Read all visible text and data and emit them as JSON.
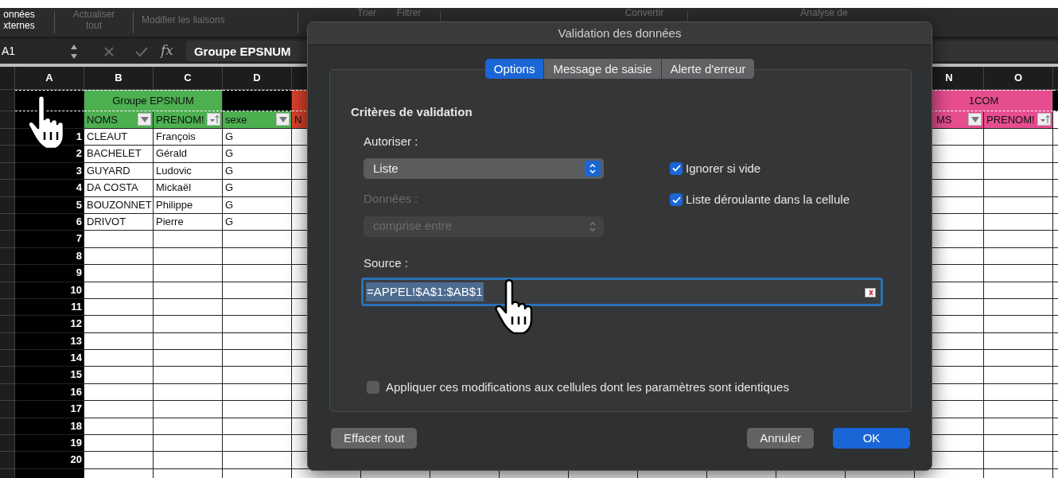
{
  "ribbon": {
    "items": [
      {
        "label": "onnées xternes",
        "disabled": false
      },
      {
        "label": "Actualiser tout",
        "disabled": true
      },
      {
        "label": "Modifier les liaisons",
        "disabled": true
      },
      {
        "label": "Trier",
        "disabled": true
      },
      {
        "label": "Filtrer",
        "disabled": true
      },
      {
        "label": "Convertir",
        "disabled": true
      },
      {
        "label": "Analyse de",
        "disabled": true
      }
    ]
  },
  "formula_bar": {
    "name_box": "A1",
    "function_label": "fx",
    "content": "Groupe EPSNUM"
  },
  "sheet": {
    "left_columns": [
      {
        "label": "A"
      },
      {
        "label": "B"
      },
      {
        "label": "C"
      },
      {
        "label": "D"
      }
    ],
    "right_columns": [
      {
        "label": "N"
      },
      {
        "label": "O"
      }
    ],
    "left_group": {
      "title": "Groupe EPSNUM",
      "color": "#4caf50",
      "headers": [
        {
          "label": "NOMS",
          "kind": "filter"
        },
        {
          "label": "PRENOM!",
          "kind": "sort"
        },
        {
          "label": "sexe",
          "kind": "filter"
        }
      ],
      "next_column": {
        "label": "N",
        "color": "#d9412c"
      }
    },
    "right_group": {
      "title": "1COM",
      "color": "#e64d8f",
      "headers": [
        {
          "label": "MS",
          "kind": "filter"
        },
        {
          "label": "PRENOM!",
          "kind": "sort"
        }
      ]
    },
    "rows": [
      {
        "number": "1",
        "cells": [
          "CLEAUT",
          "François",
          "G"
        ]
      },
      {
        "number": "2",
        "cells": [
          "BACHELET",
          "Gérald",
          "G"
        ]
      },
      {
        "number": "3",
        "cells": [
          "GUYARD",
          "Ludovic",
          "G"
        ]
      },
      {
        "number": "4",
        "cells": [
          "DA COSTA",
          "Mickaël",
          "G"
        ]
      },
      {
        "number": "5",
        "cells": [
          "BOUZONNET",
          "Philippe",
          "G"
        ]
      },
      {
        "number": "6",
        "cells": [
          "DRIVOT",
          "Pierre",
          "G"
        ]
      },
      {
        "number": "7"
      },
      {
        "number": "8"
      },
      {
        "number": "9"
      },
      {
        "number": "10"
      },
      {
        "number": "11"
      },
      {
        "number": "12"
      },
      {
        "number": "13"
      },
      {
        "number": "14"
      },
      {
        "number": "15"
      },
      {
        "number": "16"
      },
      {
        "number": "17"
      },
      {
        "number": "18"
      },
      {
        "number": "19"
      },
      {
        "number": "20"
      }
    ]
  },
  "dialog": {
    "title": "Validation des données",
    "tabs": [
      {
        "label": "Options",
        "selected": true
      },
      {
        "label": "Message de saisie",
        "selected": false
      },
      {
        "label": "Alerte d'erreur",
        "selected": false
      }
    ],
    "section_title": "Critères de validation",
    "allow": {
      "label": "Autoriser :",
      "value": "Liste",
      "disabled": false
    },
    "data": {
      "label": "Données :",
      "value": "comprise entre",
      "disabled": true
    },
    "checkboxes": [
      {
        "label": "Ignorer si vide",
        "checked": true
      },
      {
        "label": "Liste déroulante dans la cellule",
        "checked": true
      }
    ],
    "source": {
      "label": "Source :",
      "value": "=APPEL!$A$1:$AB$1",
      "selected": true
    },
    "apply": {
      "label": "Appliquer ces modifications aux cellules dont les paramètres sont identiques",
      "checked": false
    },
    "buttons_left": [
      {
        "label": "Effacer tout",
        "kind": "secondary"
      }
    ],
    "buttons_right": [
      {
        "label": "Annuler",
        "kind": "secondary"
      },
      {
        "label": "OK",
        "kind": "primary"
      }
    ]
  }
}
